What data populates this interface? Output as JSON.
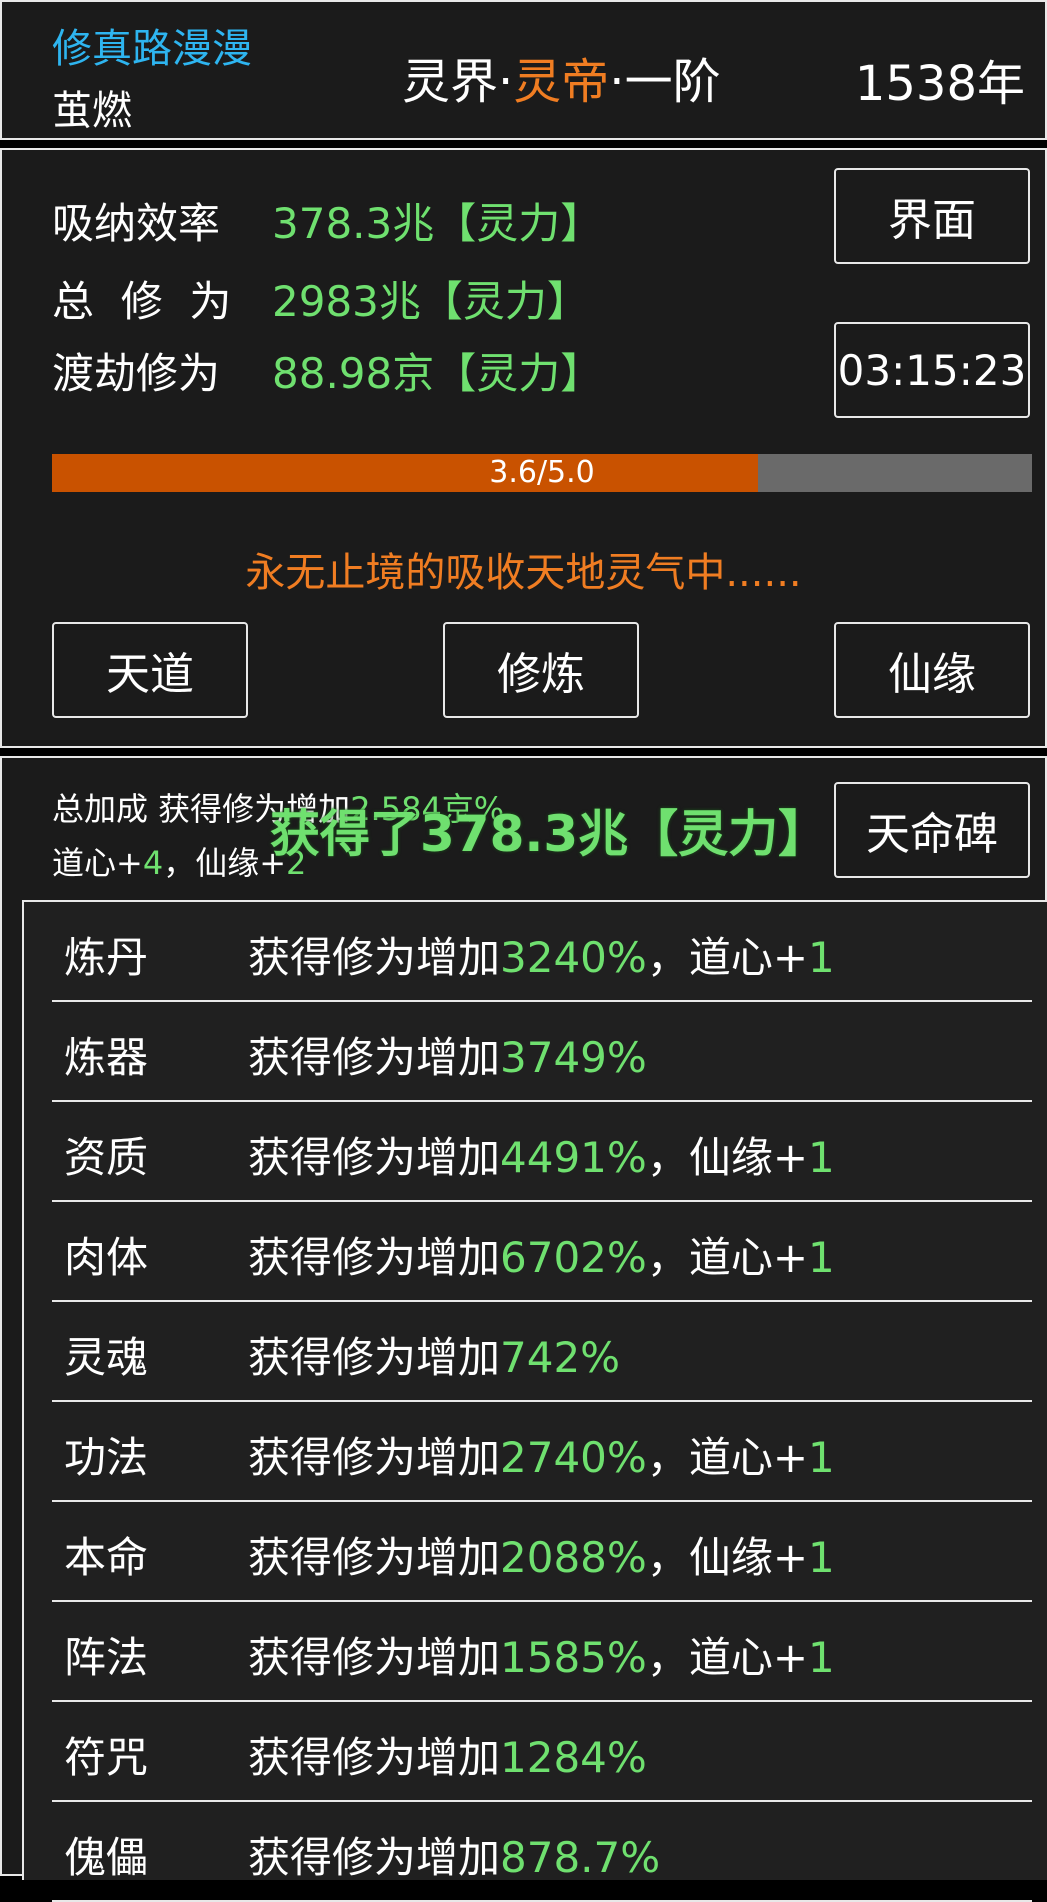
{
  "header": {
    "game_title": "修真路漫漫",
    "player_name": "茧燃",
    "realm_prefix": "灵界",
    "realm_sep1": "·",
    "realm_rank": "灵帝",
    "realm_sep2": "·",
    "realm_stage": "一阶",
    "years": "1538年"
  },
  "stats": {
    "absorb_label": "吸纳效率",
    "absorb_value": "378.3兆【灵力】",
    "total_label": "总  修  为",
    "total_value": "2983兆【灵力】",
    "tribulation_label": "渡劫修为",
    "tribulation_value": "88.98京【灵力】",
    "ui_button": "界面",
    "timer": "03:15:23",
    "progress_text": "3.6/5.0",
    "progress_value": 3.6,
    "progress_max": 5.0,
    "status_text": "永无止境的吸收天地灵气中......"
  },
  "actions": {
    "tiandao": "天道",
    "xiulian": "修炼",
    "xianyuan": "仙缘"
  },
  "bonus": {
    "line1_prefix": "总加成 获得修为增加",
    "line1_value": "2.584京%",
    "daoxin_label": "道心+",
    "daoxin_value": "4",
    "sep": "，",
    "xianyuan_label": "仙缘+",
    "xianyuan_value": "2",
    "tianmingbei": "天命碑",
    "popup": "获得了378.3兆【灵力】"
  },
  "list": [
    {
      "name": "炼丹",
      "prefix": "获得修为增加",
      "value": "3240%",
      "extra_label": "，道心+",
      "extra_value": "1"
    },
    {
      "name": "炼器",
      "prefix": "获得修为增加",
      "value": "3749%",
      "extra_label": "",
      "extra_value": ""
    },
    {
      "name": "资质",
      "prefix": "获得修为增加",
      "value": "4491%",
      "extra_label": "，仙缘+",
      "extra_value": "1"
    },
    {
      "name": "肉体",
      "prefix": "获得修为增加",
      "value": "6702%",
      "extra_label": "，道心+",
      "extra_value": "1"
    },
    {
      "name": "灵魂",
      "prefix": "获得修为增加",
      "value": "742%",
      "extra_label": "",
      "extra_value": ""
    },
    {
      "name": "功法",
      "prefix": "获得修为增加",
      "value": "2740%",
      "extra_label": "，道心+",
      "extra_value": "1"
    },
    {
      "name": "本命",
      "prefix": "获得修为增加",
      "value": "2088%",
      "extra_label": "，仙缘+",
      "extra_value": "1"
    },
    {
      "name": "阵法",
      "prefix": "获得修为增加",
      "value": "1585%",
      "extra_label": "，道心+",
      "extra_value": "1"
    },
    {
      "name": "符咒",
      "prefix": "获得修为增加",
      "value": "1284%",
      "extra_label": "",
      "extra_value": ""
    },
    {
      "name": "傀儡",
      "prefix": "获得修为增加",
      "value": "878.7%",
      "extra_label": "",
      "extra_value": ""
    }
  ],
  "colors": {
    "accent_green": "#6fe06f",
    "accent_orange": "#f07d22",
    "progress_fill": "#c95200",
    "title_blue": "#2eb5f0"
  }
}
